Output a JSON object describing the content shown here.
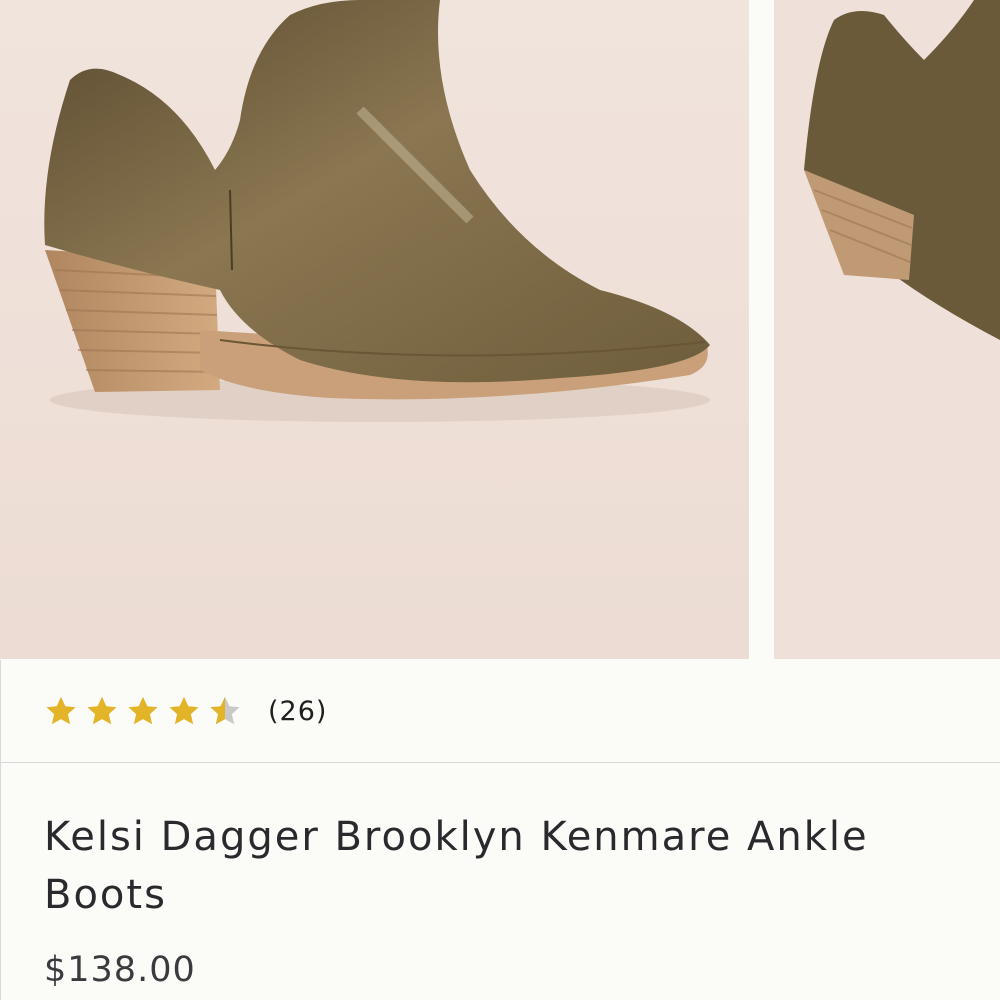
{
  "gallery": {
    "main_image": "ankle-boot-side-view",
    "peek_image": "ankle-boot-angle-view"
  },
  "rating": {
    "stars": 4.5,
    "max_stars": 5,
    "count_label": "(26)",
    "star_color": "#e3b427",
    "empty_star_color": "#c9c9c9"
  },
  "product": {
    "title": "Kelsi Dagger Brooklyn Kenmare Ankle Boots",
    "price": "$138.00"
  }
}
